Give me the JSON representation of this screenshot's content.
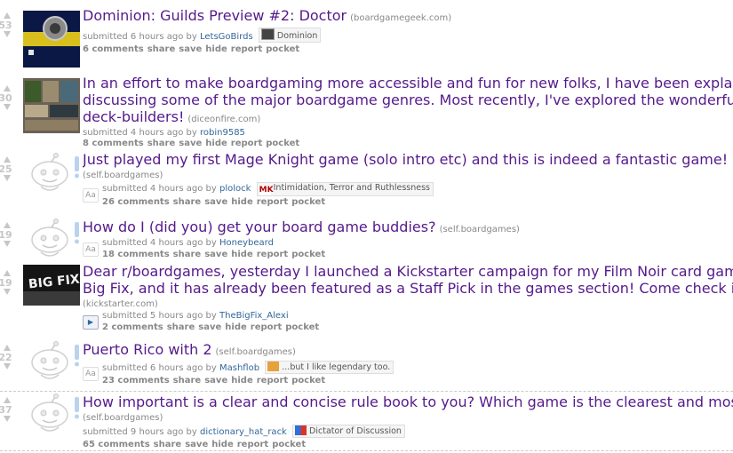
{
  "posts": [
    {
      "score": "53",
      "title": "Dominion: Guilds Preview #2: Doctor",
      "domain": "(boardgamegeek.com)",
      "tagline_prefix": "submitted 6 hours ago by",
      "author": "LetsGoBirds",
      "flair": "Dominion",
      "comments": "6 comments"
    },
    {
      "score": "30",
      "title_lines": [
        "In an effort to make boardgaming more accessible and fun for new folks, I have been explaining ar",
        "discussing some of the major boardgame genres. Most recently, I've explored the wonderful world",
        "deck-builders!"
      ],
      "domain": "(diceonfire.com)",
      "tagline_prefix": "submitted 4 hours ago by",
      "author": "robin9585",
      "comments": "8 comments"
    },
    {
      "score": "25",
      "title": "Just played my first Mage Knight game (solo intro etc) and this is indeed a fantastic game!",
      "domain": "(self.boardgames)",
      "tagline_prefix": "submitted 4 hours ago by",
      "author": "plolock",
      "flair": "Intimidation, Terror and Ruthlessness",
      "comments": "26 comments"
    },
    {
      "score": "19",
      "title": "How do I (did you) get your board game buddies?",
      "domain": "(self.boardgames)",
      "tagline_prefix": "submitted 4 hours ago by",
      "author": "Honeybeard",
      "comments": "18 comments"
    },
    {
      "score": "19",
      "title_lines": [
        "Dear r/boardgames, yesterday I launched a Kickstarter campaign for my Film Noir card game, The",
        "Big Fix, and it has already been featured as a Staff Pick in the games section! Come check it out :)"
      ],
      "domain": "(kickstarter.com)",
      "tagline_prefix": "submitted 5 hours ago by",
      "author": "TheBigFix_Alexi",
      "comments": "2 comments"
    },
    {
      "score": "22",
      "title": "Puerto Rico with 2",
      "domain": "(self.boardgames)",
      "tagline_prefix": "submitted 6 hours ago by",
      "author": "Mashflob",
      "flair": "...but I like legendary too.",
      "comments": "23 comments"
    },
    {
      "score": "37",
      "title": "How important is a clear and concise rule book to you? Which game is the clearest and most concis",
      "domain": "(self.boardgames)",
      "tagline_prefix": "submitted 9 hours ago by",
      "author": "dictionary_hat_rack",
      "flair": "Dictator of Discussion",
      "comments": "65 comments"
    }
  ],
  "actions": {
    "share": "share",
    "save": "save",
    "hide": "hide",
    "report": "report",
    "pocket": "pocket"
  },
  "expando": {
    "aa": "Aa",
    "plus": "+"
  },
  "thumb_text": {
    "bigfix": "BIG FIX",
    "mk": "MK"
  },
  "colors": {
    "title": "#551a8b",
    "meta": "#888888",
    "author": "#336699",
    "arrow": "#c6c6c6"
  }
}
